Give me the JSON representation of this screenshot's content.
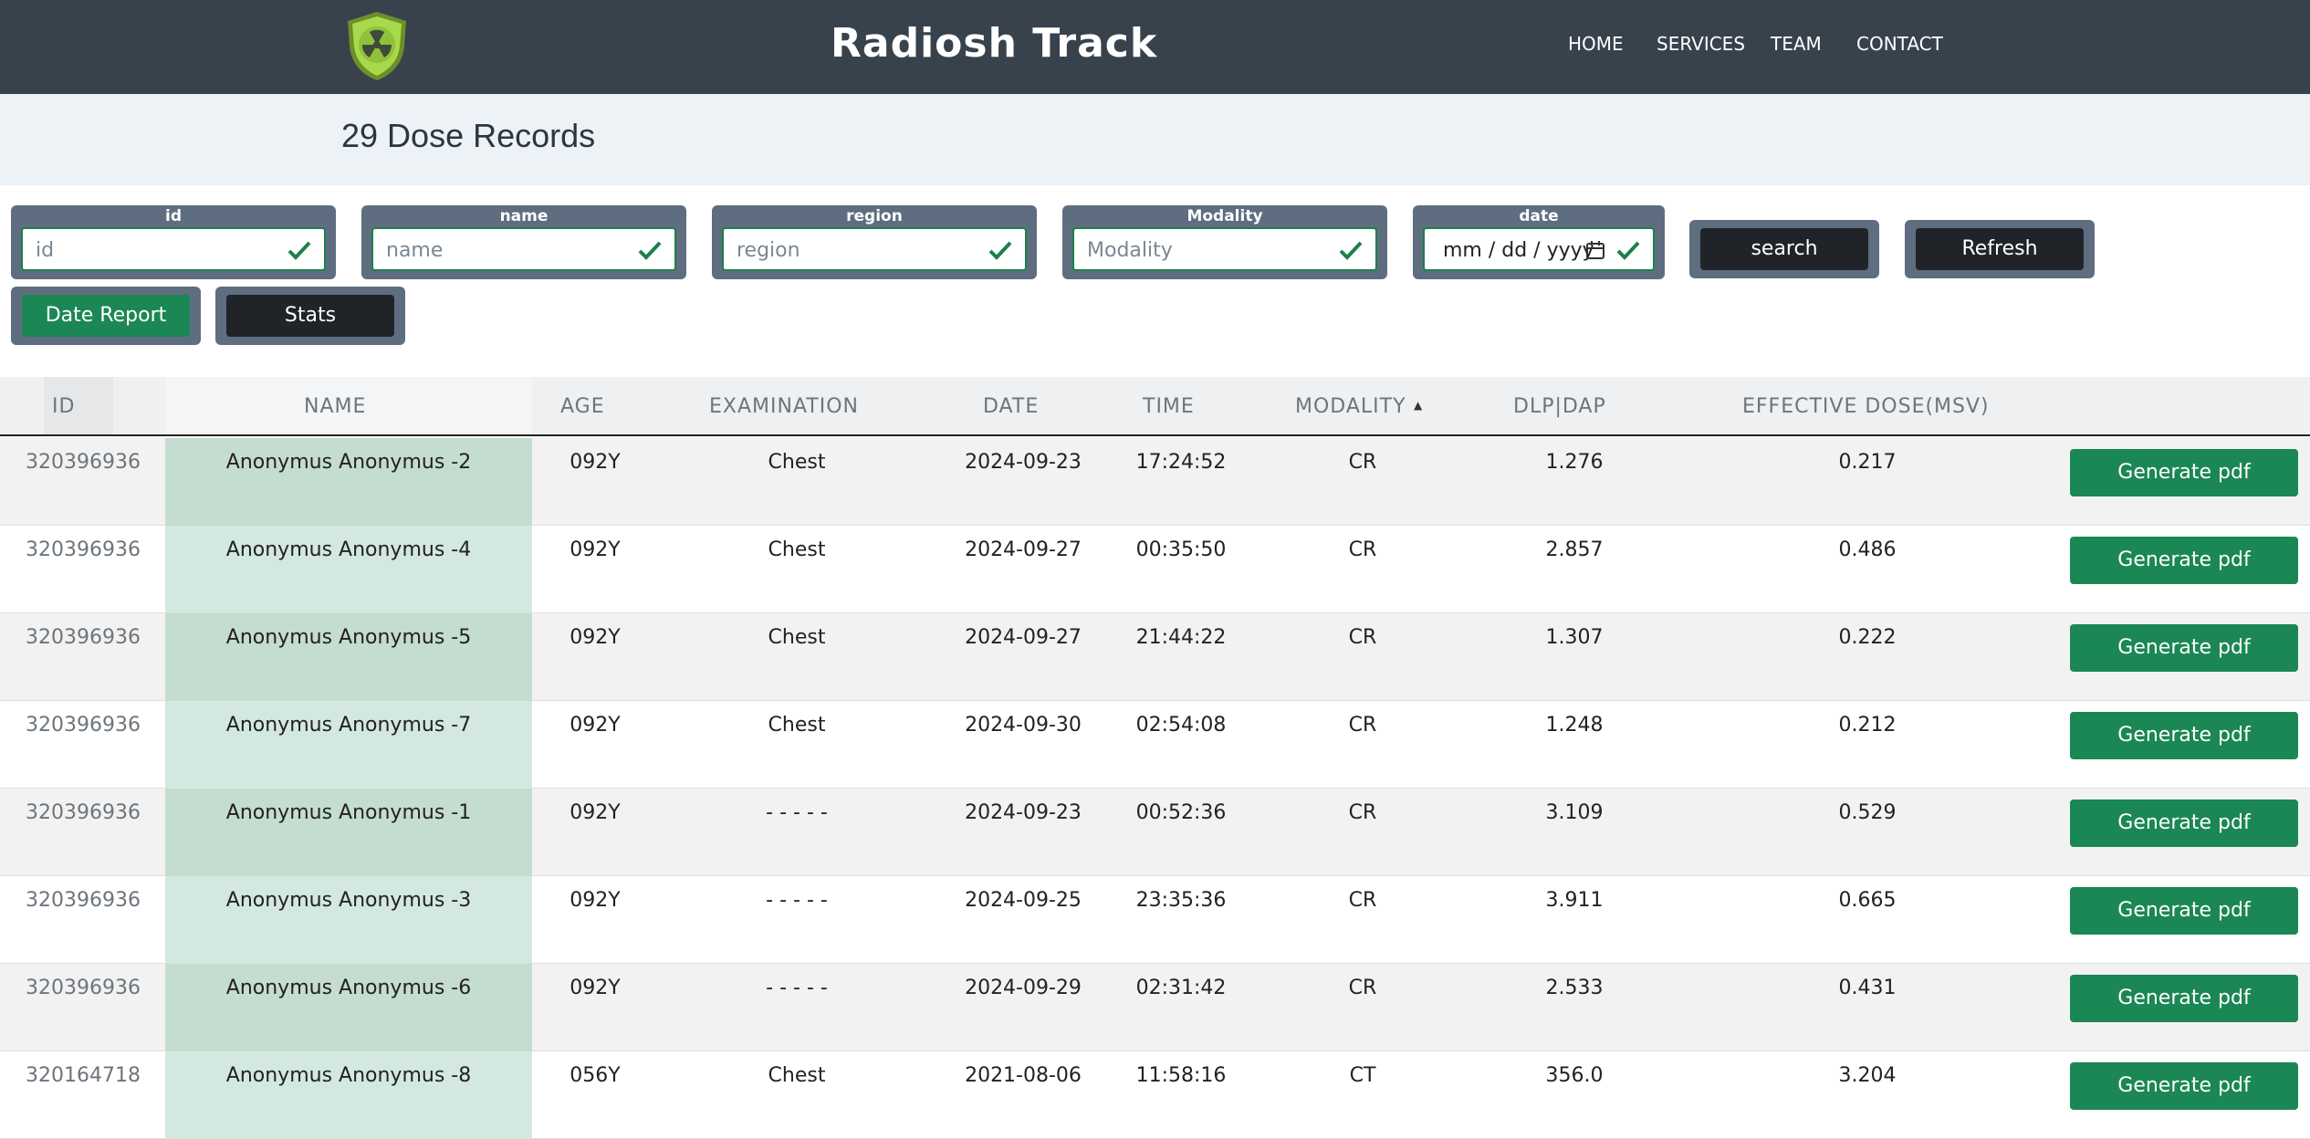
{
  "header": {
    "brand": "Radiosh Track",
    "nav": [
      "HOME",
      "SERVICES",
      "TEAM",
      "CONTACT"
    ]
  },
  "page_title": "29 Dose Records",
  "filters": [
    {
      "label": "id",
      "placeholder": "id"
    },
    {
      "label": "name",
      "placeholder": "name"
    },
    {
      "label": "region",
      "placeholder": "region"
    },
    {
      "label": "Modality",
      "placeholder": "Modality"
    },
    {
      "label": "date",
      "placeholder": "mm / dd / yyyy"
    }
  ],
  "buttons": {
    "search": "search",
    "refresh": "Refresh",
    "date_report": "Date Report",
    "stats": "Stats",
    "generate_pdf": "Generate pdf"
  },
  "table": {
    "columns": [
      "ID",
      "NAME",
      "AGE",
      "EXAMINATION",
      "DATE",
      "TIME",
      "MODALITY",
      "DLP|DAP",
      "EFFECTIVE DOSE(MSV)"
    ],
    "sort_indicator": "▲",
    "rows": [
      {
        "id": "320396936",
        "name": "Anonymus Anonymus -2",
        "age": "092Y",
        "exam": "Chest",
        "date": "2024-09-23",
        "time": "17:24:52",
        "modality": "CR",
        "dlp": "1.276",
        "dose": "0.217"
      },
      {
        "id": "320396936",
        "name": "Anonymus Anonymus -4",
        "age": "092Y",
        "exam": "Chest",
        "date": "2024-09-27",
        "time": "00:35:50",
        "modality": "CR",
        "dlp": "2.857",
        "dose": "0.486"
      },
      {
        "id": "320396936",
        "name": "Anonymus Anonymus -5",
        "age": "092Y",
        "exam": "Chest",
        "date": "2024-09-27",
        "time": "21:44:22",
        "modality": "CR",
        "dlp": "1.307",
        "dose": "0.222"
      },
      {
        "id": "320396936",
        "name": "Anonymus Anonymus -7",
        "age": "092Y",
        "exam": "Chest",
        "date": "2024-09-30",
        "time": "02:54:08",
        "modality": "CR",
        "dlp": "1.248",
        "dose": "0.212"
      },
      {
        "id": "320396936",
        "name": "Anonymus Anonymus -1",
        "age": "092Y",
        "exam": "- - - - -",
        "date": "2024-09-23",
        "time": "00:52:36",
        "modality": "CR",
        "dlp": "3.109",
        "dose": "0.529"
      },
      {
        "id": "320396936",
        "name": "Anonymus Anonymus -3",
        "age": "092Y",
        "exam": "- - - - -",
        "date": "2024-09-25",
        "time": "23:35:36",
        "modality": "CR",
        "dlp": "3.911",
        "dose": "0.665"
      },
      {
        "id": "320396936",
        "name": "Anonymus Anonymus -6",
        "age": "092Y",
        "exam": "- - - - -",
        "date": "2024-09-29",
        "time": "02:31:42",
        "modality": "CR",
        "dlp": "2.533",
        "dose": "0.431"
      },
      {
        "id": "320164718",
        "name": "Anonymus Anonymus -8",
        "age": "056Y",
        "exam": "Chest",
        "date": "2021-08-06",
        "time": "11:58:16",
        "modality": "CT",
        "dlp": "356.0",
        "dose": "3.204"
      }
    ]
  },
  "colors": {
    "navbar": "#37424d",
    "accent_green": "#1b8754",
    "filter_bg": "#5e6e80",
    "dark_button": "#202429"
  },
  "icons": {
    "logo": "radiation-shield-logo",
    "field_valid": "check-icon",
    "date_picker": "calendar-icon"
  }
}
